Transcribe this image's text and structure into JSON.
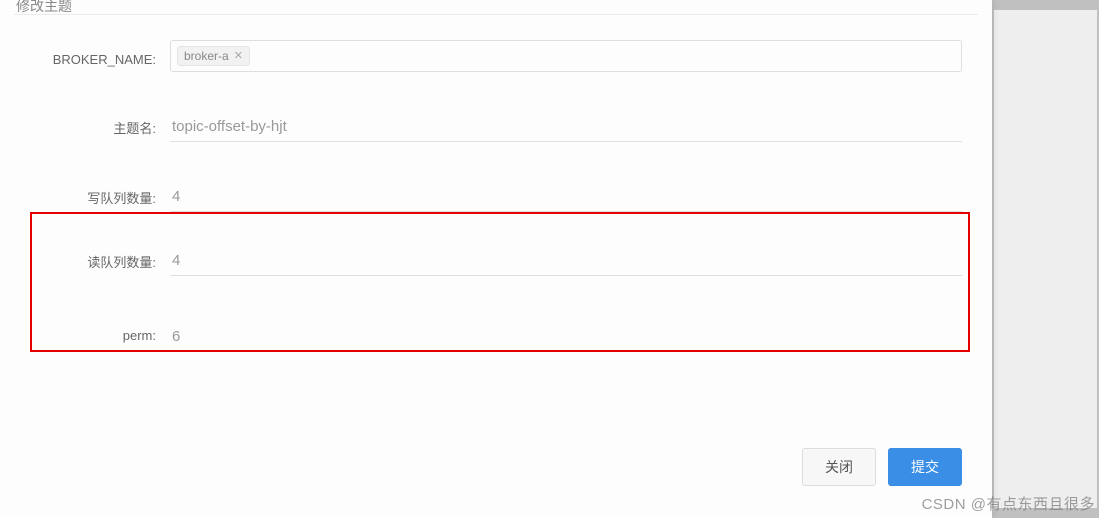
{
  "modal": {
    "title": "修改主题"
  },
  "form": {
    "broker_name_label": "BROKER_NAME:",
    "broker_tag": "broker-a",
    "topic_label": "主题名:",
    "topic_value": "topic-offset-by-hjt",
    "write_queue_label": "写队列数量:",
    "write_queue_value": "4",
    "read_queue_label": "读队列数量:",
    "read_queue_value": "4",
    "perm_label": "perm:",
    "perm_value": "6"
  },
  "footer": {
    "close_label": "关闭",
    "submit_label": "提交"
  },
  "watermark": "CSDN @有点东西且很多"
}
